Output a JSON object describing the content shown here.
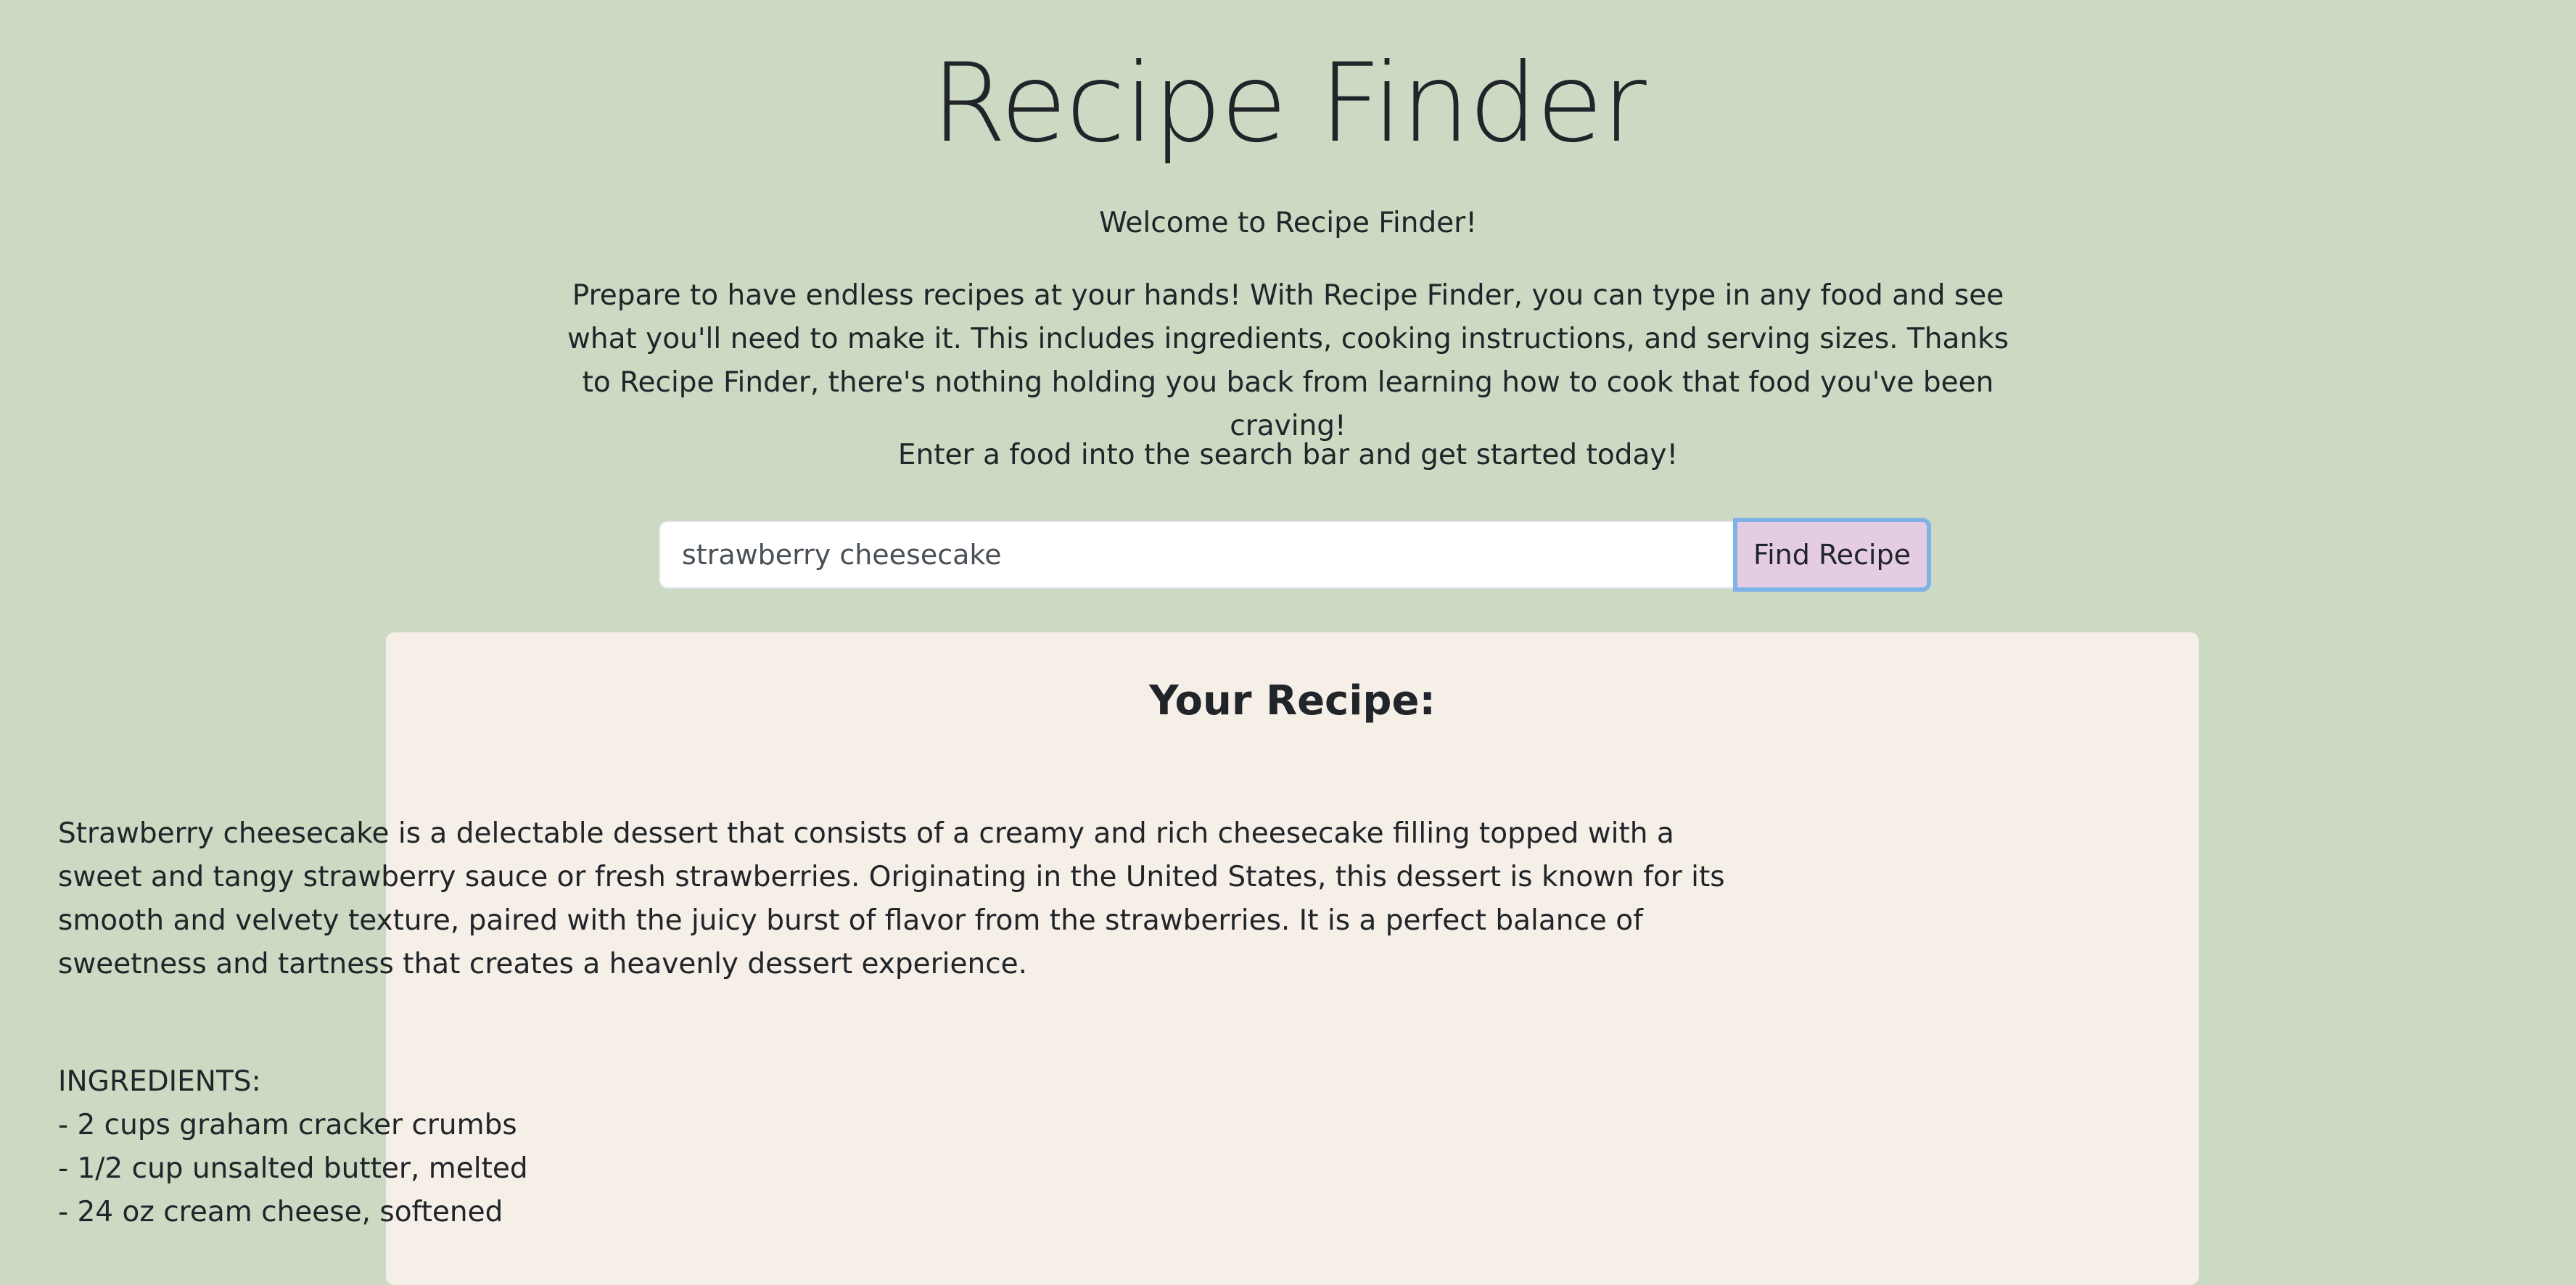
{
  "header": {
    "title": "Recipe Finder"
  },
  "intro": {
    "welcome": "Welcome to Recipe Finder!",
    "description": "Prepare to have endless recipes at your hands! With Recipe Finder, you can type in any food and see what you'll need to make it. This includes ingredients, cooking instructions, and serving sizes. Thanks to Recipe Finder, there's nothing holding you back from learning how to cook that food you've been craving!",
    "cta": "Enter a food into the search bar and get started today!"
  },
  "search": {
    "value": "strawberry cheesecake",
    "button_label": "Find Recipe"
  },
  "recipe": {
    "heading": "Your Recipe:",
    "description": "Strawberry cheesecake is a delectable dessert that consists of a creamy and rich cheesecake filling topped with a sweet and tangy strawberry sauce or fresh strawberries. Originating in the United States, this dessert is known for its smooth and velvety texture, paired with the juicy burst of flavor from the strawberries. It is a perfect balance of sweetness and tartness that creates a heavenly dessert experience.",
    "ingredients_label": "INGREDIENTS:",
    "ingredients": [
      "- 2 cups graham cracker crumbs",
      "- 1/2 cup unsalted butter, melted",
      "- 24 oz cream cheese, softened"
    ]
  },
  "colors": {
    "page_background": "#ccd9c3",
    "card_background": "#f5efe7",
    "button_background": "#e4cce3",
    "button_focus_ring": "#7fb3e6"
  }
}
